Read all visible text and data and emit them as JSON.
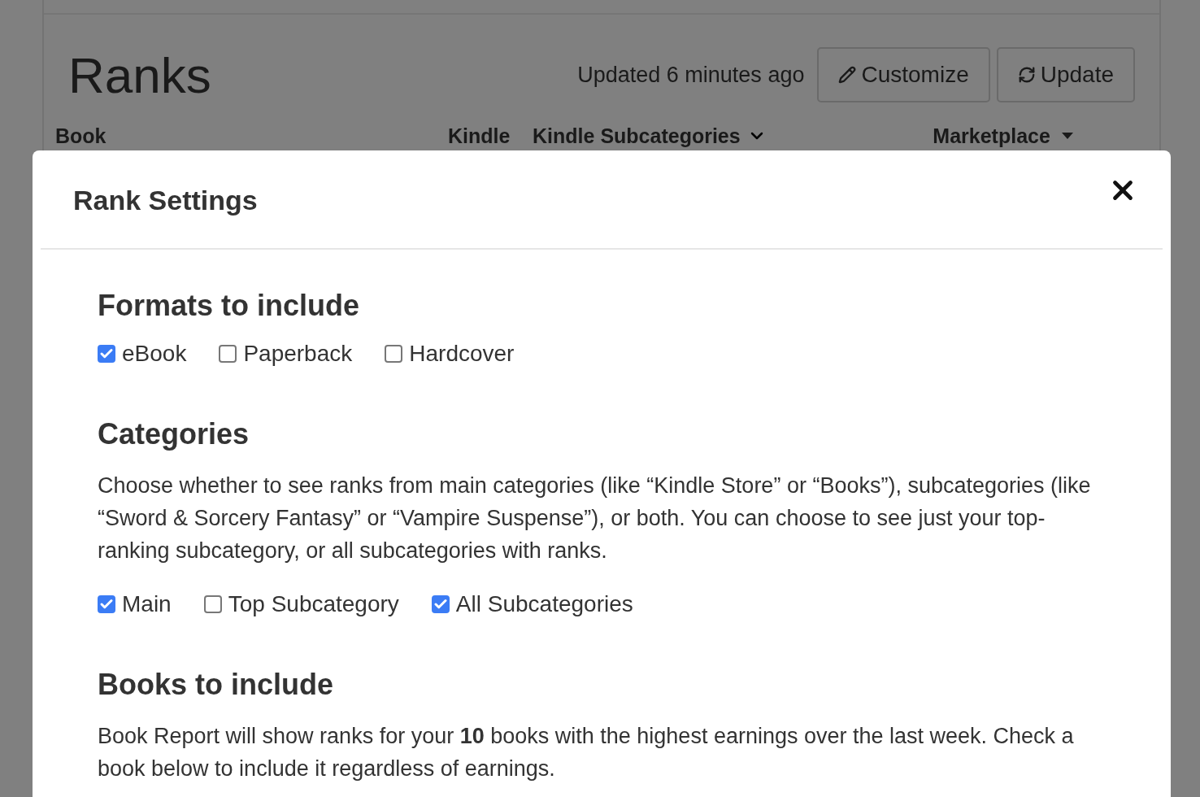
{
  "page": {
    "title": "Ranks",
    "updated": "Updated 6 minutes ago",
    "buttons": [
      {
        "kind": "edit",
        "label": "Customize"
      },
      {
        "kind": "refresh",
        "label": "Update"
      }
    ],
    "columns": [
      {
        "label": "Book",
        "kind": "plain"
      },
      {
        "label": "Kindle",
        "kind": "plain"
      },
      {
        "label": "Kindle Subcategories",
        "kind": "chevron"
      },
      {
        "label": "Marketplace",
        "kind": "caret"
      }
    ]
  },
  "dialog": {
    "title": "Rank Settings",
    "sections": [
      {
        "heading": "Formats to include",
        "options": [
          {
            "label": "eBook",
            "checked": true
          },
          {
            "label": "Paperback",
            "checked": false
          },
          {
            "label": "Hardcover",
            "checked": false
          }
        ]
      },
      {
        "heading": "Categories",
        "text": "Choose whether to see ranks from main categories (like “Kindle Store” or “Books”), subcategories (like “Sword & Sorcery Fantasy” or “Vampire Suspense”), or both. You can choose to see just your top-ranking subcategory, or all subcategories with ranks.",
        "options": [
          {
            "label": "Main",
            "checked": true
          },
          {
            "label": "Top Subcategory",
            "checked": false
          },
          {
            "label": "All Subcategories",
            "checked": true
          }
        ]
      },
      {
        "heading": "Books to include",
        "text": "Book Report will show ranks for your **10** books with the highest earnings over the last week. Check a book below to include it regardless of earnings."
      }
    ]
  }
}
